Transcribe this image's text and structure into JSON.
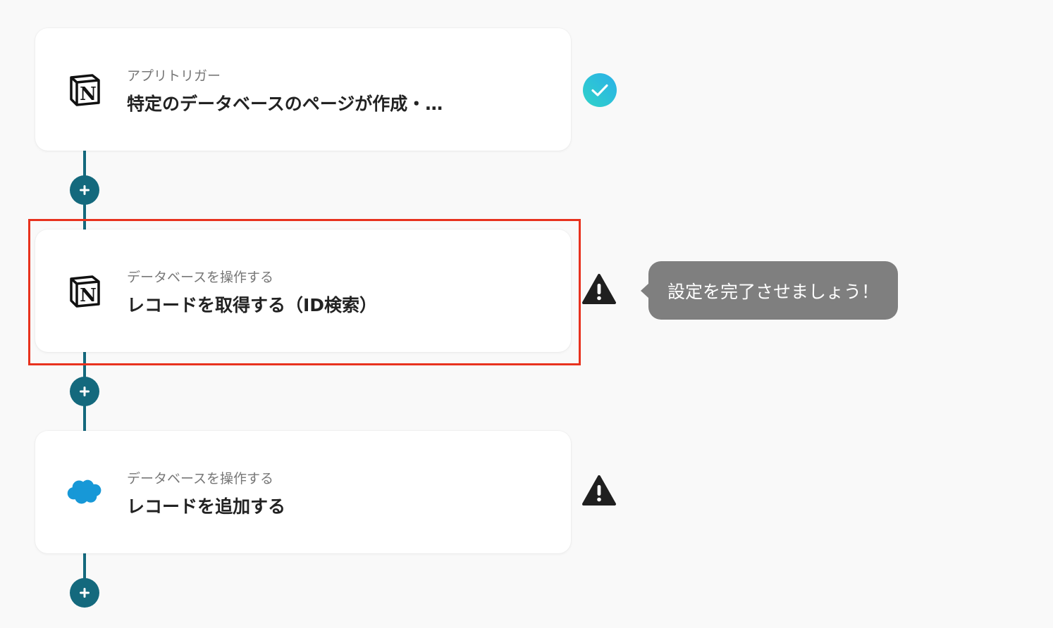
{
  "steps": [
    {
      "subtitle": "アプリトリガー",
      "title": "特定のデータベースのページが作成・…",
      "app_icon": "notion-icon",
      "status": "completed"
    },
    {
      "subtitle": "データベースを操作する",
      "title": "レコードを取得する（ID検索）",
      "app_icon": "notion-icon",
      "status": "warning"
    },
    {
      "subtitle": "データベースを操作する",
      "title": "レコードを追加する",
      "app_icon": "salesforce-icon",
      "status": "warning"
    }
  ],
  "tooltip": {
    "text": "設定を完了させましょう！"
  },
  "colors": {
    "background": "#f9f9f9",
    "connector": "#14697d",
    "highlight": "#e8321e",
    "check_gradient_start": "#30d3c8",
    "check_gradient_end": "#2ab0e8",
    "warning": "#1f1f1f",
    "tooltip": "#7f7f7f",
    "salesforce": "#1798d7"
  }
}
